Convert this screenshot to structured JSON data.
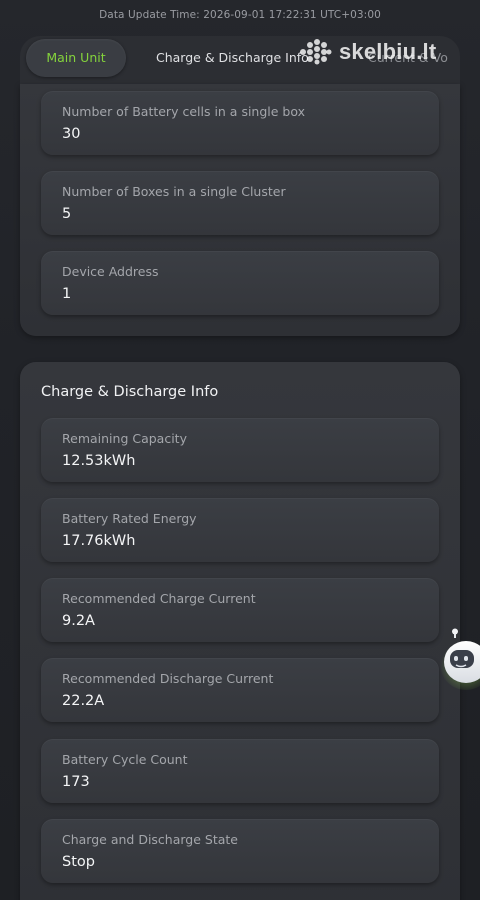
{
  "header": {
    "update_time": "Data Update Time: 2026-09-01 17:22:31 UTC+03:00"
  },
  "tabs": [
    {
      "label": "Main Unit",
      "active": true
    },
    {
      "label": "Charge & Discharge Info",
      "active": false
    },
    {
      "label": "Current & Vo",
      "active": false
    }
  ],
  "watermark": {
    "text": "skelbiu.lt"
  },
  "main_unit": {
    "fields": [
      {
        "label": "Number of Battery cells in a single box",
        "value": "30"
      },
      {
        "label": "Number of Boxes in a single Cluster",
        "value": "5"
      },
      {
        "label": "Device Address",
        "value": "1"
      }
    ]
  },
  "charge_discharge": {
    "title": "Charge & Discharge Info",
    "fields": [
      {
        "label": "Remaining Capacity",
        "value": "12.53kWh"
      },
      {
        "label": "Battery Rated Energy",
        "value": "17.76kWh"
      },
      {
        "label": "Recommended Charge Current",
        "value": "9.2A"
      },
      {
        "label": "Recommended Discharge Current",
        "value": "22.2A"
      },
      {
        "label": "Battery Cycle Count",
        "value": "173"
      },
      {
        "label": "Charge and Discharge State",
        "value": "Stop"
      }
    ]
  },
  "colors": {
    "accent_green": "#84d33c",
    "background": "#1c1e22",
    "card": "#2e3035"
  },
  "icons": {
    "assistant": "robot-assistant-icon",
    "watermark_logo": "dot-grid-logo-icon"
  }
}
